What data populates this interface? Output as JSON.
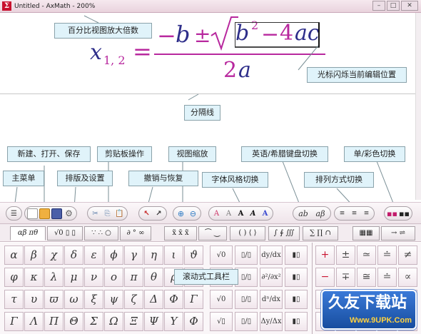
{
  "window": {
    "title": "Untitled - AxMath - 200%",
    "controls": [
      "–",
      "□",
      "✕"
    ]
  },
  "formula": {
    "lhs_var": "x",
    "lhs_sub": "1, 2",
    "equals": "=",
    "neg": "−",
    "b": "b",
    "pm": "±",
    "sqrt_b": "b",
    "exp": "2",
    "minus": "−",
    "four": "4",
    "ac": "ac",
    "denom_num": "2",
    "denom_var": "a"
  },
  "callouts": {
    "zoom_pct": "百分比视图放大倍数",
    "cursor_pos": "光标闪烁当前编辑位置",
    "separator": "分隔线",
    "new_open_save": "新建、打开、保存",
    "clipboard": "剪贴板操作",
    "view_zoom": "视图缩放",
    "lang_switch": "英语/希腊键盘切换",
    "color_switch": "单/彩色切换",
    "main_menu": "主菜单",
    "layout_settings": "排版及设置",
    "undo_redo": "撤销与恢复",
    "font_style": "字体风格切换",
    "align_switch": "排列方式切换",
    "scroll_toolbar": "滚动式工具栏"
  },
  "toolbar": {
    "menu": "☰",
    "new": "",
    "open": "",
    "save": "",
    "settings": "⚙",
    "cut": "✂",
    "copy": "⎘",
    "paste": "📋",
    "undo": "↖",
    "redo": "↗",
    "zoom_in": "⊕",
    "zoom_out": "⊖",
    "font_a1": "A",
    "font_a2": "A",
    "font_a3": "A",
    "font_a4": "A",
    "font_a5": "A",
    "lang_en": "ab",
    "lang_gr": "aβ",
    "align_left": "≡",
    "align_center": "≡",
    "align_right": "≡",
    "color_mode": "▪▪",
    "mono_mode": "▪▪"
  },
  "tabs": [
    "αβ πθ",
    "√0 ▯ ▯",
    "∵ ∴ ○",
    "∂ ° ∞",
    "x̃ x̄ x̃",
    "⏜ ⏝",
    "( ) ⟨ ⟩",
    "∫ ∮ ∭",
    "∑ ∏ ∩",
    "▦▦",
    "→ ⇌"
  ],
  "greek": [
    [
      "α",
      "β",
      "χ",
      "δ",
      "ε",
      "ϕ",
      "γ",
      "η",
      "ι",
      "ϑ"
    ],
    [
      "φ",
      "κ",
      "λ",
      "μ",
      "ν",
      "ο",
      "π",
      "θ",
      "ρ",
      "σ"
    ],
    [
      "τ",
      "υ",
      "ϖ",
      "ω",
      "ξ",
      "ψ",
      "ζ",
      "Δ",
      "Φ",
      "Γ"
    ],
    [
      "Γ",
      "Λ",
      "Π",
      "Θ",
      "Σ",
      "Ω",
      "Ξ",
      "Ψ",
      "Υ",
      "Φ"
    ]
  ],
  "templates": [
    [
      "√0",
      "▯/▯",
      "dy/dx",
      "▮▯"
    ],
    [
      "√▯",
      "▯/▯",
      "∂²/∂x²",
      "▮▯"
    ],
    [
      "√0",
      "▯/▯",
      "dⁿ/dx",
      "▮▯"
    ],
    [
      "√▯",
      "▯/▯",
      "Δy/Δx",
      "▮▯"
    ]
  ],
  "relations": [
    [
      "+",
      "±",
      "≃",
      "≐",
      "≠"
    ],
    [
      "−",
      "∓",
      "≅",
      "≐",
      "∝"
    ],
    [
      "×",
      "·",
      "≈",
      "≙",
      "≤"
    ],
    [
      "÷",
      "∘",
      "≡",
      "≜",
      "≥"
    ]
  ],
  "watermark": {
    "text": "久友下载站",
    "url": "Www.9UPK.Com"
  }
}
